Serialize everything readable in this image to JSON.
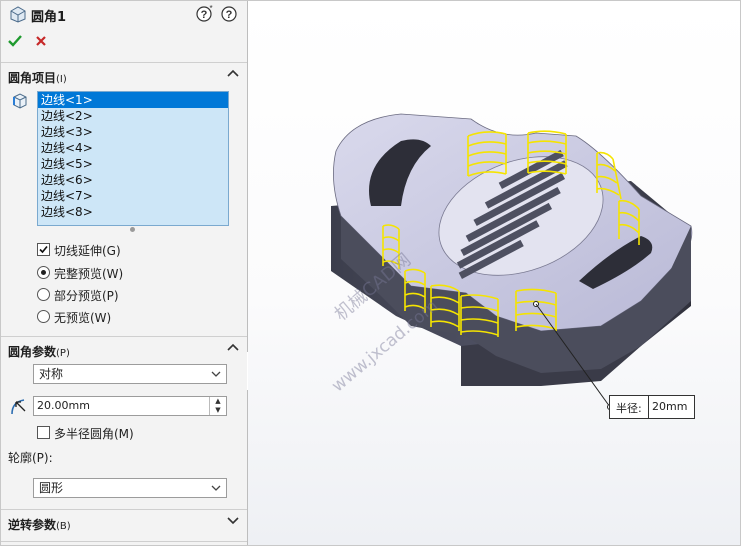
{
  "panel": {
    "title": "圆角1",
    "help_icon": "help-icon",
    "help2_icon": "question-icon",
    "ok_icon": "check-icon",
    "cancel_icon": "close-icon",
    "items_section": {
      "title": "圆角项目",
      "accel": "(I)",
      "edges": [
        "边线<1>",
        "边线<2>",
        "边线<3>",
        "边线<4>",
        "边线<5>",
        "边线<6>",
        "边线<7>",
        "边线<8>"
      ],
      "selected_index": 0,
      "tangent_label": "切线延伸(G)",
      "tangent_checked": true,
      "preview_options": [
        "完整预览(W)",
        "部分预览(P)",
        "无预览(W)"
      ],
      "preview_selected": 0
    },
    "params_section": {
      "title": "圆角参数",
      "accel": "(P)",
      "method": "对称",
      "radius": "20.00mm",
      "multi_radius_label": "多半径圆角(M)",
      "multi_radius_checked": false,
      "profile_label": "轮廓(P):",
      "profile": "圆形"
    },
    "reverse_section": {
      "title": "逆转参数",
      "accel": "(B)"
    }
  },
  "viewport": {
    "callout_key": "半径:",
    "callout_value": "20mm",
    "watermark_1": "机械CAD网",
    "watermark_2": "www.jxcad.com",
    "accent": "#f5e400",
    "body_color": "#4b4d5c",
    "top_color": "#c9c9e0"
  }
}
